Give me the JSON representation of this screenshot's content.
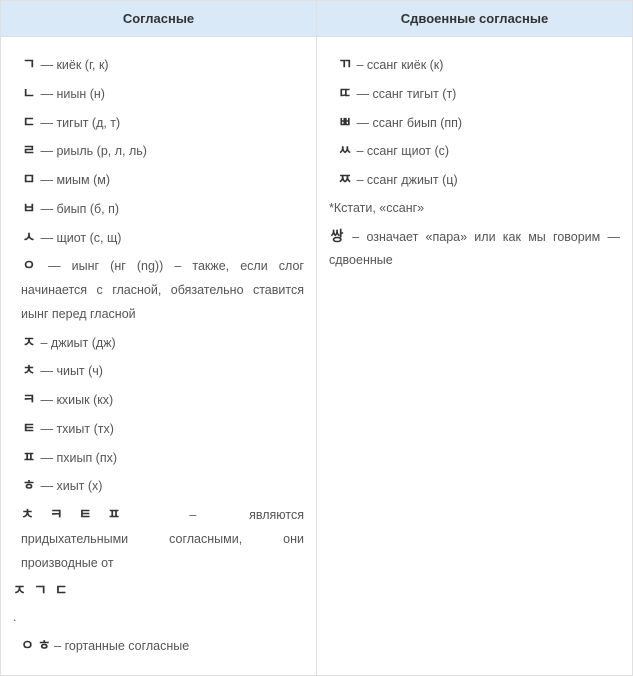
{
  "headers": {
    "col1": "Согласные",
    "col2": "Сдвоенные согласные"
  },
  "col1": {
    "rows": [
      {
        "jamo": "ㄱ",
        "sep": "—",
        "desc": "киёк (г, к)"
      },
      {
        "jamo": "ㄴ",
        "sep": "—",
        "desc": "ниын (н)"
      },
      {
        "jamo": "ㄷ",
        "sep": "—",
        "desc": "тигыт (д, т)"
      },
      {
        "jamo": "ㄹ",
        "sep": "—",
        "desc": "риыль (р, л, ль)"
      },
      {
        "jamo": "ㅁ",
        "sep": "—",
        "desc": "миым (м)"
      },
      {
        "jamo": "ㅂ",
        "sep": "—",
        "desc": "биып (б, п)"
      },
      {
        "jamo": "ㅅ",
        "sep": "—",
        "desc": "щиот (с, щ)"
      },
      {
        "jamo": "ㅇ",
        "sep": "—",
        "desc": "иынг (нг (ng)) – также, если слог начинается с гласной, обязательно ставится иынг перед гласной"
      },
      {
        "jamo": "ㅈ",
        "sep": "–",
        "desc": "джиыт (дж)"
      },
      {
        "jamo": "ㅊ",
        "sep": "—",
        "desc": "чиыт (ч)"
      },
      {
        "jamo": "ㅋ",
        "sep": "—",
        "desc": "кхиык (кх)"
      },
      {
        "jamo": "ㅌ",
        "sep": "—",
        "desc": "тхиыт (тх)"
      },
      {
        "jamo": "ㅍ",
        "sep": "—",
        "desc": "пхиып (пх)"
      },
      {
        "jamo": "ㅎ",
        "sep": "—",
        "desc": "хиыт (х)"
      }
    ],
    "aspirated": {
      "group": "ㅊㅋㅌㅍ",
      "sep": "–",
      "text": "являются придыхательными согласными, они производные от"
    },
    "derived_from": "ㅈㄱㄷ",
    "dot": ".",
    "guttural": {
      "group": "ㅇ ㅎ",
      "sep": "–",
      "text": "гортанные согласные"
    }
  },
  "col2": {
    "rows": [
      {
        "jamo": "ㄲ",
        "sep": "–",
        "desc": "ссанг киёк (к)"
      },
      {
        "jamo": "ㄸ",
        "sep": "—",
        "desc": "ссанг тигыт (т)"
      },
      {
        "jamo": "ㅃ",
        "sep": "—",
        "desc": "ссанг биып (пп)"
      },
      {
        "jamo": "ㅆ",
        "sep": "–",
        "desc": "ссанг щиот (с)"
      },
      {
        "jamo": "ㅉ",
        "sep": "–",
        "desc": "ссанг джиыт (ц)"
      }
    ],
    "note1": "*Кстати, «ссанг»",
    "ssang": {
      "jamo": "쌍",
      "sep": "–",
      "text": "означает «пара» или как мы говорим — сдвоенные"
    }
  }
}
